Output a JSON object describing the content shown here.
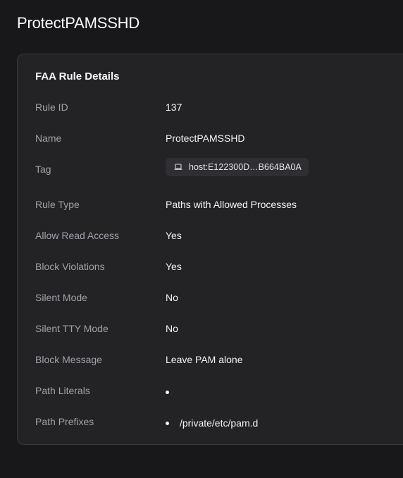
{
  "page": {
    "title": "ProtectPAMSSHD"
  },
  "card": {
    "title": "FAA Rule Details",
    "rows": {
      "rule_id": {
        "label": "Rule ID",
        "value": "137"
      },
      "name": {
        "label": "Name",
        "value": "ProtectPAMSSHD"
      },
      "tag": {
        "label": "Tag",
        "value": "host:E122300D…B664BA0A",
        "icon": "laptop-icon"
      },
      "rule_type": {
        "label": "Rule Type",
        "value": "Paths with Allowed Processes"
      },
      "allow_read_access": {
        "label": "Allow Read Access",
        "value": "Yes"
      },
      "block_violations": {
        "label": "Block Violations",
        "value": "Yes"
      },
      "silent_mode": {
        "label": "Silent Mode",
        "value": "No"
      },
      "silent_tty_mode": {
        "label": "Silent TTY Mode",
        "value": "No"
      },
      "block_message": {
        "label": "Block Message",
        "value": "Leave PAM alone"
      },
      "path_literals": {
        "label": "Path Literals",
        "items": [
          ""
        ]
      },
      "path_prefixes": {
        "label": "Path Prefixes",
        "items": [
          "/private/etc/pam.d"
        ]
      }
    }
  },
  "colors": {
    "background": "#18181b",
    "card_background": "#232325",
    "label": "#a1a1aa",
    "value": "#f4f4f5"
  }
}
